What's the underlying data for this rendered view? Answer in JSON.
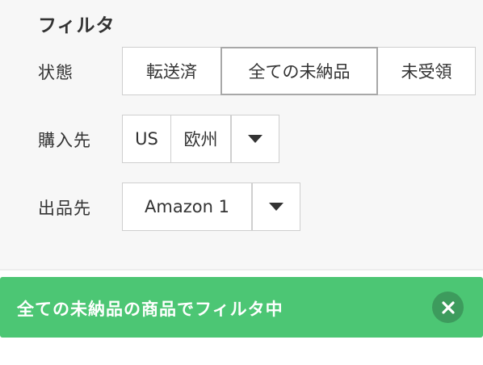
{
  "filter": {
    "title": "フィルタ",
    "status": {
      "label": "状態",
      "options": [
        "転送済",
        "全ての未納品",
        "未受領"
      ],
      "selected": "全ての未納品"
    },
    "purchase": {
      "label": "購入先",
      "options": [
        "US",
        "欧州"
      ]
    },
    "listing": {
      "label": "出品先",
      "selected": "Amazon 1"
    }
  },
  "toast": {
    "message": "全ての未納品の商品でフィルタ中",
    "background_color": "#4cc674"
  },
  "icons": {
    "dropdown": "caret-down-icon",
    "close": "close-icon"
  }
}
